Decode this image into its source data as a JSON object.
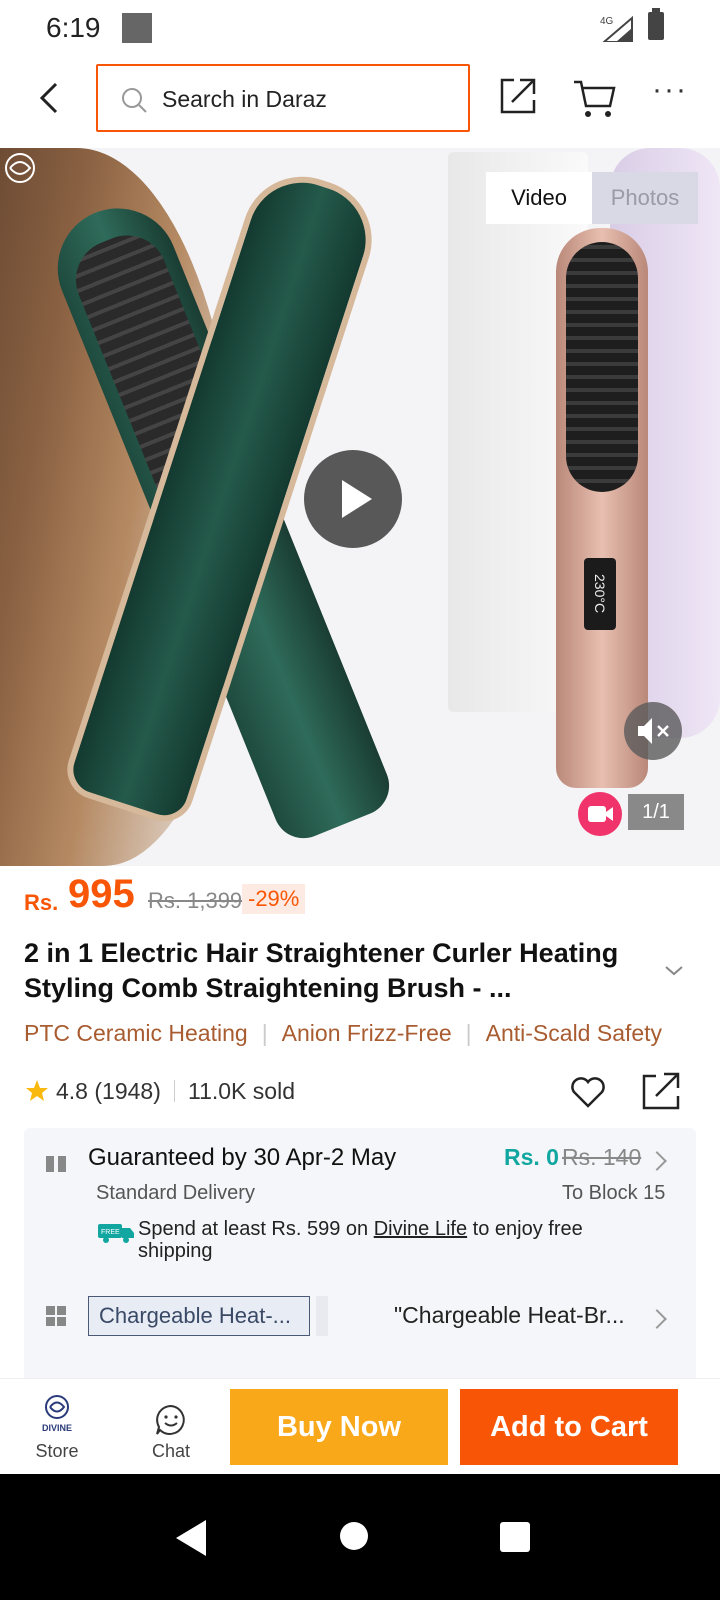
{
  "status_bar": {
    "time": "6:19",
    "network": "4G"
  },
  "header": {
    "search_placeholder": "Search in Daraz",
    "icons": [
      "back-arrow-icon",
      "share-icon",
      "cart-icon",
      "more-icon"
    ]
  },
  "media": {
    "tabs": [
      {
        "label": "Video",
        "active": true
      },
      {
        "label": "Photos",
        "active": false
      }
    ],
    "page_indicator": "1/1",
    "display_temp": "230°C"
  },
  "price": {
    "currency": "Rs.",
    "value": "995",
    "original": "Rs. 1,399",
    "discount": "-29%"
  },
  "product": {
    "title": "2 in 1 Electric Hair Straightener Curler Heating Styling Comb Straightening Brush - ...",
    "tags": [
      "PTC Ceramic Heating",
      "Anion Frizz-Free",
      "Anti-Scald Safety"
    ],
    "rating": "4.8",
    "rating_count": "(1948)",
    "sold": "11.0K sold"
  },
  "delivery": {
    "guarantee": "Guaranteed by 30 Apr-2 May",
    "fee": "Rs. 0",
    "fee_original": "Rs. 140",
    "method": "Standard Delivery",
    "location": "To Block 15",
    "free_prefix": "Spend at least Rs. 599 on ",
    "free_link": "Divine Life",
    "free_suffix": " to enjoy free shipping",
    "free_badge": "FREE",
    "variant_chip": "Chargeable Heat-...",
    "variant_selected": "\"Chargeable Heat-Br..."
  },
  "actions": {
    "store_label": "Store",
    "store_logo_text": "DIVINE",
    "chat_label": "Chat",
    "buy_now": "Buy Now",
    "add_to_cart": "Add to Cart"
  },
  "colors": {
    "brand_orange": "#f85606",
    "buy_now": "#f9a81a",
    "free_teal": "#11a7a0",
    "tag_brown": "#a85c30"
  }
}
